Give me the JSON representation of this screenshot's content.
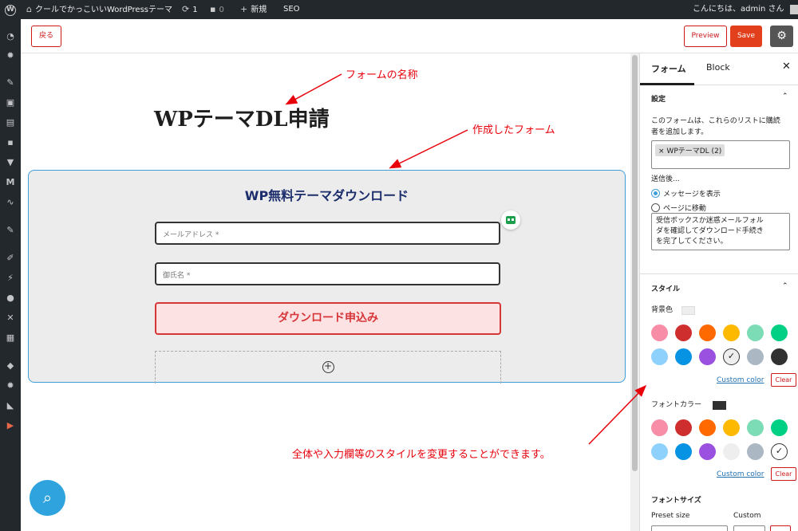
{
  "adminbar": {
    "site_name": "クールでかっこいいWordPressテーマ",
    "updates_count": "1",
    "comments_count": "0",
    "new_label": "新規",
    "seo_label": "SEO",
    "greeting": "こんにちは、admin さん"
  },
  "toolbar": {
    "back_label": "戻る",
    "preview_label": "Preview",
    "save_label": "Save"
  },
  "canvas": {
    "page_title": "WPテーマDL申請",
    "form": {
      "heading": "WP無料テーマダウンロード",
      "email_placeholder": "メールアドレス *",
      "name_placeholder": "御氏名 *",
      "submit_label": "ダウンロード申込み"
    }
  },
  "annotations": {
    "form_name": "フォームの名称",
    "created_form": "作成したフォーム",
    "style_note": "全体や入力欄等のスタイルを変更することができます。"
  },
  "panel": {
    "tabs": [
      "フォーム",
      "Block"
    ],
    "settings": {
      "title": "設定",
      "description_line1": "このフォームは、これらのリストに購読",
      "description_line2": "者を追加します。",
      "list_token": "WPテーマDL (2)",
      "after_submit_label": "送信後...",
      "option_show_message": "メッセージを表示",
      "option_goto_page": "ページに移動",
      "message_line1": "受信ボックスか迷惑メールフォル",
      "message_line2": "ダを確認してダウンロード手続き",
      "message_line3": "を完了してください。"
    },
    "style": {
      "title": "スタイル",
      "bg_color_label": "背景色",
      "font_color_label": "フォントカラー",
      "custom_color_link": "Custom color",
      "clear_label": "Clear",
      "font_size_label": "フォントサイズ",
      "preset_size_label": "Preset size",
      "custom_label": "Custom"
    },
    "palette": [
      "#f78da7",
      "#cf2e2e",
      "#ff6900",
      "#fcb900",
      "#7bdcb5",
      "#00d084",
      "#8ed1fc",
      "#0693e3",
      "#9b51e0",
      "#eeeeee",
      "#abb8c3",
      "#313131"
    ]
  },
  "colors": {
    "accent_red": "#e2401c",
    "form_border": "#3e9ed8",
    "annotation": "#e8000b"
  }
}
